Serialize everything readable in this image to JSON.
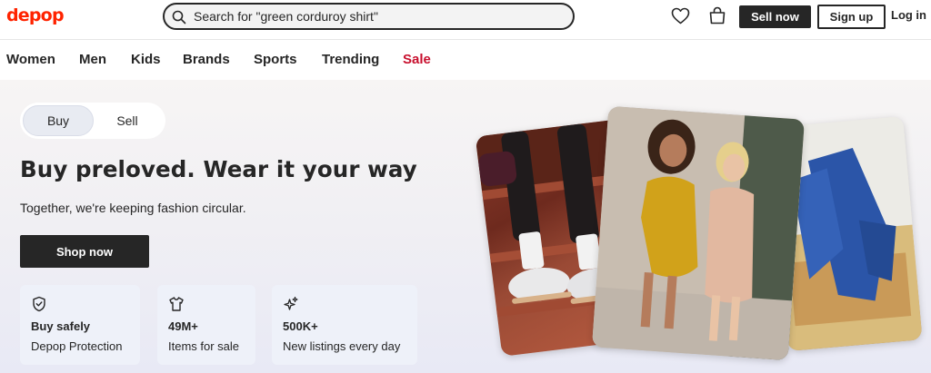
{
  "header": {
    "logo": "depop",
    "search": {
      "value": "",
      "placeholder": "Search for \"green corduroy shirt\""
    },
    "sell_label": "Sell now",
    "signup_label": "Sign up",
    "login_label": "Log in"
  },
  "nav": {
    "items": [
      {
        "label": "Women"
      },
      {
        "label": "Men"
      },
      {
        "label": "Kids"
      },
      {
        "label": "Brands"
      },
      {
        "label": "Sports"
      },
      {
        "label": "Trending"
      },
      {
        "label": "Sale"
      }
    ]
  },
  "hero": {
    "toggle": {
      "buy_label": "Buy",
      "sell_label": "Sell",
      "selected": "Buy"
    },
    "headline": "Buy preloved. Wear it your way",
    "subline": "Together, we're keeping fashion circular.",
    "cta_label": "Shop now",
    "features": [
      {
        "icon": "shield-check-icon",
        "title": "Buy safely",
        "subtitle": "Depop Protection"
      },
      {
        "icon": "tshirt-icon",
        "title": "49M+",
        "subtitle": "Items for sale"
      },
      {
        "icon": "sparkle-icon",
        "title": "500K+",
        "subtitle": "New listings every day"
      }
    ],
    "photos": [
      {
        "name": "sneakers-photo"
      },
      {
        "name": "friends-walking-photo"
      },
      {
        "name": "blue-garment-chair-photo"
      }
    ]
  },
  "colors": {
    "brand": "#ff2300",
    "sale": "#c8102e",
    "dark": "#262626"
  }
}
